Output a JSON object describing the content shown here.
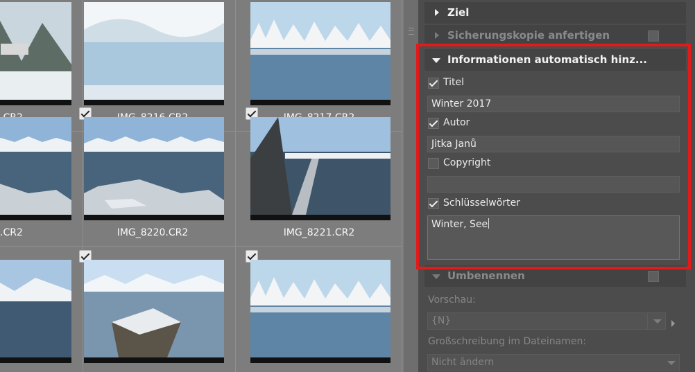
{
  "grid": {
    "cells": [
      {
        "file": "",
        "checked": false,
        "scene": "forest"
      },
      {
        "file": "IMG_8216.CR2",
        "checked": false,
        "scene": "lake-bright"
      },
      {
        "file": "IMG_8217.CR2",
        "checked": false,
        "scene": "lake-trees"
      },
      {
        "file": "",
        "checked": false,
        "scene": "ice"
      },
      {
        "file": "IMG_8220.CR2",
        "checked": true,
        "scene": "ice"
      },
      {
        "file": "IMG_8221.CR2",
        "checked": true,
        "scene": "path"
      },
      {
        "file": "",
        "checked": false,
        "scene": "shore"
      },
      {
        "file": "",
        "checked": true,
        "scene": "post"
      },
      {
        "file": "",
        "checked": true,
        "scene": "lake-trees"
      }
    ],
    "cut_label": ".CR2"
  },
  "panel": {
    "ziel_label": "Ziel",
    "backup_label": "Sicherungskopie anfertigen",
    "info_label": "Informationen automatisch hinz...",
    "title_cb": "Titel",
    "title_value": "Winter 2017",
    "author_cb": "Autor",
    "author_value": "Jitka Janů",
    "copyright_cb": "Copyright",
    "copyright_value": "",
    "keywords_cb": "Schlüsselwörter",
    "keywords_value": "Winter, See",
    "rename_label": "Umbenennen",
    "preview_label": "Vorschau:",
    "preview_value": "{N}",
    "case_label": "Großschreibung im Dateinamen:",
    "case_value": "Nicht ändern"
  },
  "colors": {
    "highlight": "#e11a1a",
    "panel_bg": "#4c4c4c",
    "grid_bg": "#7d7d7d"
  }
}
